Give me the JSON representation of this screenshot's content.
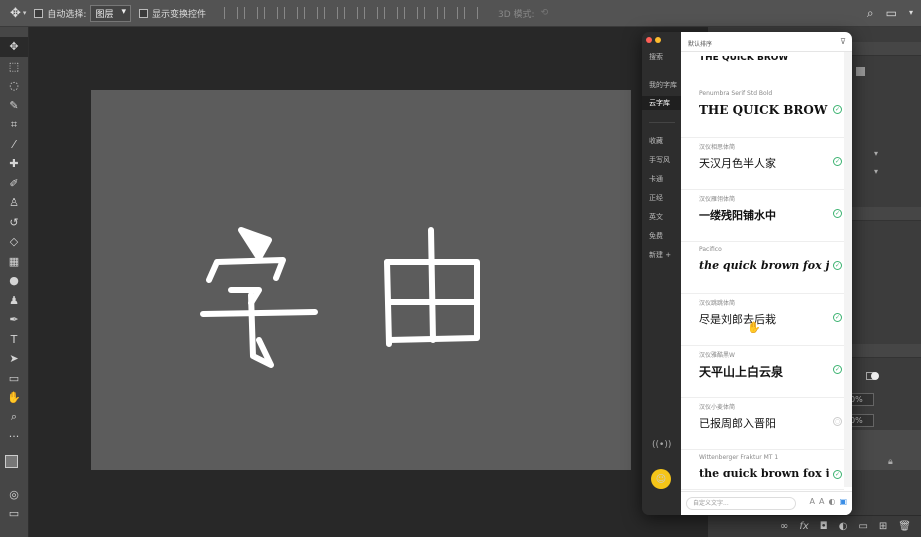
{
  "options_bar": {
    "auto_select_label": "自动选择:",
    "auto_select_value": "图层",
    "show_transform_label": "显示变换控件",
    "mode_3d_label": "3D 模式:"
  },
  "toolbar_icons": [
    "move-tool-icon",
    "marquee-tool-icon",
    "lasso-tool-icon",
    "quick-select-tool-icon",
    "crop-tool-icon",
    "eyedropper-tool-icon",
    "healing-brush-icon",
    "brush-tool-icon",
    "clone-stamp-icon",
    "history-brush-icon",
    "eraser-tool-icon",
    "gradient-tool-icon",
    "blur-tool-icon",
    "dodge-tool-icon",
    "pen-tool-icon",
    "type-tool-icon",
    "path-select-icon",
    "rectangle-tool-icon",
    "hand-tool-icon",
    "zoom-tool-icon",
    "more-tools-icon"
  ],
  "canvas": {
    "text": "字由",
    "background": "#5c5c5c"
  },
  "fontapp": {
    "nav": {
      "search": "搜索",
      "my_library": "我的字库",
      "cloud_library": "云字库",
      "categories": [
        "收藏",
        "手写风",
        "卡通",
        "正经",
        "英文",
        "免费",
        "新建 +"
      ]
    },
    "sort_label": "默认排序",
    "fonts": [
      {
        "name": "Penumbra Serif Std Bold",
        "preview": "THE QUICK BROW",
        "installed": true
      },
      {
        "name": "汉仪相思体简",
        "preview": "天汉月色半人家",
        "installed": true
      },
      {
        "name": "汉仪雁翎体简",
        "preview": "一缕残阳铺水中",
        "installed": true
      },
      {
        "name": "Pacifico",
        "preview": "the quick brown fox jumps",
        "installed": true
      },
      {
        "name": "汉仪跳跳体简",
        "preview": "尽是刘郎去后栽",
        "installed": true
      },
      {
        "name": "汉仪雅酷黑W",
        "preview": "天平山上白云泉",
        "installed": true
      },
      {
        "name": "汉仪小麦体简",
        "preview": "已报周郎入晋阳",
        "installed": false
      },
      {
        "name": "Wittenberger Fraktur MT 1",
        "preview": "the quick brown fox jumps",
        "installed": true
      }
    ],
    "custom_text_placeholder": "自定义文字..."
  },
  "right_panel": {
    "zoom_value_1": "0%",
    "zoom_value_2": "0%"
  }
}
